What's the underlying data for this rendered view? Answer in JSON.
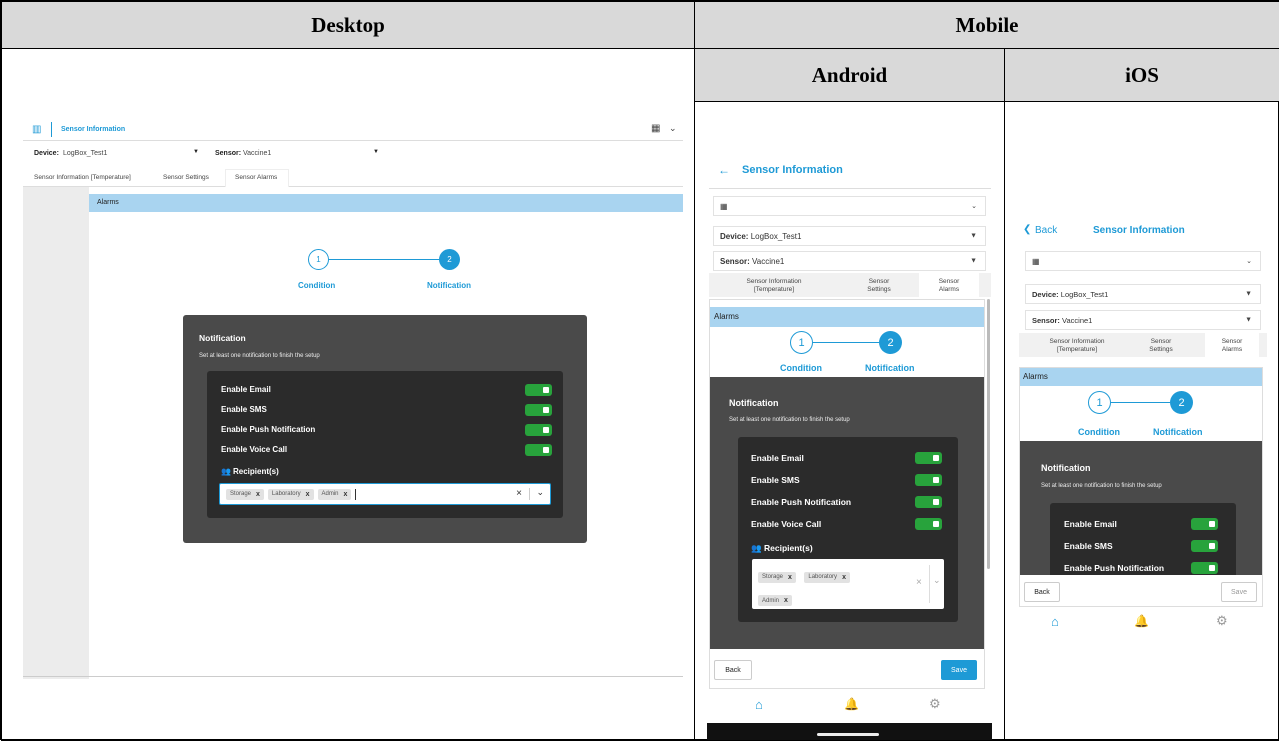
{
  "table": {
    "desktop_header": "Desktop",
    "mobile_header": "Mobile",
    "android_header": "Android",
    "ios_header": "iOS"
  },
  "app": {
    "title": "Sensor Information",
    "device_label": "Device:",
    "device_value": "LogBox_Test1",
    "sensor_label": "Sensor:",
    "sensor_value": "Vaccine1",
    "tabs_desktop": [
      "Sensor Information [Temperature]",
      "Sensor Settings",
      "Sensor Alarms"
    ],
    "tabs_mobile": [
      [
        "Sensor Information",
        "[Temperature]"
      ],
      [
        "Sensor",
        "Settings"
      ],
      [
        "Sensor",
        "Alarms"
      ]
    ],
    "alarms_title": "Alarms",
    "step1_num": "1",
    "step2_num": "2",
    "step1_label": "Condition",
    "step2_label": "Notification",
    "notif_title": "Notification",
    "notif_desc": "Set at least one notification to finish the setup",
    "toggles": [
      "Enable Email",
      "Enable SMS",
      "Enable Push Notification",
      "Enable Voice Call"
    ],
    "recipients_label": "Recipient(s)",
    "chips": [
      "Storage",
      "Laboratory",
      "Admin"
    ],
    "chip_x": "x",
    "clear_x": "×",
    "back_label": "Back",
    "save_label": "Save",
    "ios_back": "Back"
  },
  "colors": {
    "accent": "#1e9ad6",
    "toggle_on": "#28a33c",
    "panel_dark": "#4a4a4a",
    "panel_darker": "#2b2b2b",
    "alarm_bar": "#a9d4f0"
  }
}
